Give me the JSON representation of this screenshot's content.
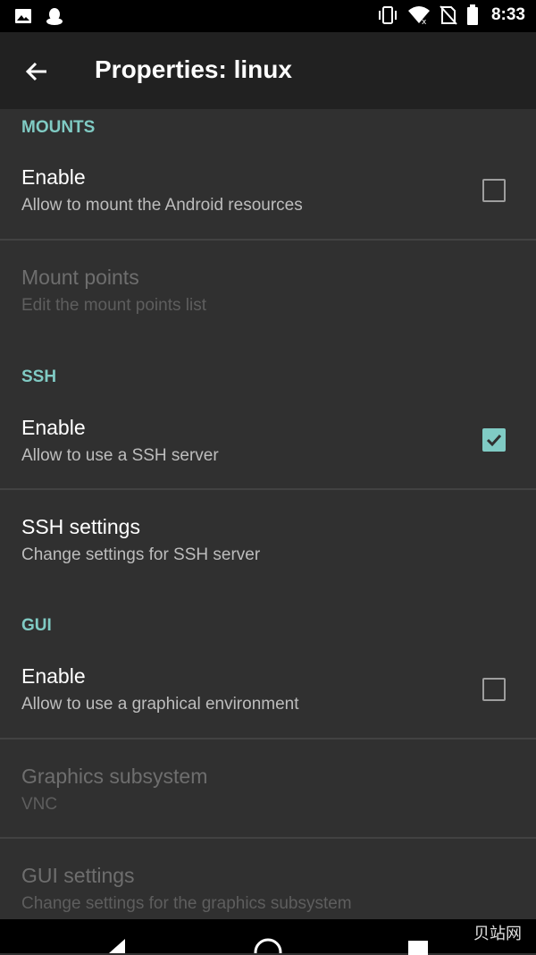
{
  "status_bar": {
    "time": "8:33",
    "left_icons": [
      "image-icon",
      "qq-icon"
    ],
    "right_icons": [
      "vibrate-icon",
      "wifi-icon",
      "no-sim-icon",
      "battery-icon"
    ]
  },
  "app_bar": {
    "title": "Properties: linux"
  },
  "sections": {
    "mounts": {
      "header": "MOUNTS",
      "enable": {
        "title": "Enable",
        "subtitle": "Allow to mount the Android resources",
        "checked": false
      },
      "mount_points": {
        "title": "Mount points",
        "subtitle": "Edit the mount points list",
        "enabled": false
      }
    },
    "ssh": {
      "header": "SSH",
      "enable": {
        "title": "Enable",
        "subtitle": "Allow to use a SSH server",
        "checked": true
      },
      "settings": {
        "title": "SSH settings",
        "subtitle": "Change settings for SSH server",
        "enabled": true
      }
    },
    "gui": {
      "header": "GUI",
      "enable": {
        "title": "Enable",
        "subtitle": "Allow to use a graphical environment",
        "checked": false
      },
      "graphics": {
        "title": "Graphics subsystem",
        "subtitle": "VNC",
        "enabled": false
      },
      "settings": {
        "title": "GUI settings",
        "subtitle": "Change settings for the graphics subsystem",
        "enabled": false
      }
    }
  },
  "nav_bar": {
    "watermark": "贝站网",
    "buttons": [
      "back-icon",
      "home-icon",
      "recents-icon"
    ]
  },
  "colors": {
    "accent": "#80cbc4",
    "background": "#303030",
    "app_bar": "#212121",
    "divider": "#424242"
  }
}
